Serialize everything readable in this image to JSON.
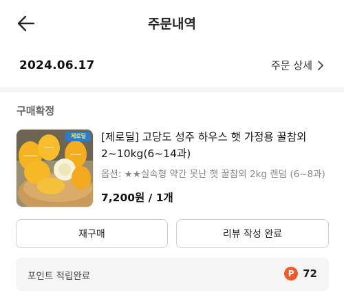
{
  "header": {
    "title": "주문내역",
    "back_icon": "arrow-left-icon"
  },
  "order": {
    "date": "2024.06.17",
    "detail_label": "주문 상세",
    "detail_icon": "chevron-right-icon"
  },
  "status": "구매확정",
  "product": {
    "image_icon": "korean-melon-photo",
    "image_badge": "제로딜",
    "title": "[제로딜] 고당도 성주 하우스 햇 가정용 꿀참외 2~10kg(6~14과)",
    "option": "옵션: ★★실속형 약간 못난 햇 꿀참외 2kg 랜덤 (6~8과)",
    "price": "7,200원 / 1개"
  },
  "buttons": {
    "rebuy": "재구매",
    "review": "리뷰 작성 완료"
  },
  "points": {
    "label": "포인트 적립완료",
    "icon_letter": "P",
    "value": "72"
  },
  "colors": {
    "point_icon": "#f25c2a",
    "melon": "#f5b321"
  }
}
